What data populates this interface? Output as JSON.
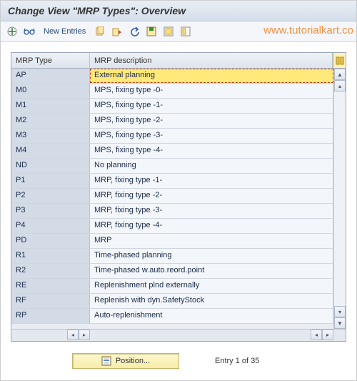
{
  "title": "Change View \"MRP Types\": Overview",
  "watermark": "www.tutorialkart.co",
  "toolbar": {
    "new_entries": "New Entries"
  },
  "table": {
    "headers": {
      "col1": "MRP Type",
      "col2": "MRP description"
    },
    "rows": [
      {
        "type": "AP",
        "desc": "External planning",
        "selected": true
      },
      {
        "type": "M0",
        "desc": "MPS, fixing type -0-"
      },
      {
        "type": "M1",
        "desc": "MPS, fixing type -1-"
      },
      {
        "type": "M2",
        "desc": "MPS, fixing type -2-"
      },
      {
        "type": "M3",
        "desc": "MPS, fixing type  -3-"
      },
      {
        "type": "M4",
        "desc": "MPS, fixing type -4-"
      },
      {
        "type": "ND",
        "desc": "No planning"
      },
      {
        "type": "P1",
        "desc": "MRP, fixing type -1-"
      },
      {
        "type": "P2",
        "desc": "MRP, fixing type -2-"
      },
      {
        "type": "P3",
        "desc": "MRP, fixing type -3-"
      },
      {
        "type": "P4",
        "desc": "MRP, fixing type -4-"
      },
      {
        "type": "PD",
        "desc": "MRP"
      },
      {
        "type": "R1",
        "desc": "Time-phased planning"
      },
      {
        "type": "R2",
        "desc": "Time-phased w.auto.reord.point"
      },
      {
        "type": "RE",
        "desc": "Replenishment plnd externally"
      },
      {
        "type": "RF",
        "desc": "Replenish with dyn.SafetyStock"
      },
      {
        "type": "RP",
        "desc": "Auto-replenishment"
      }
    ]
  },
  "footer": {
    "position_label": "Position...",
    "entry_text": "Entry 1 of 35"
  }
}
